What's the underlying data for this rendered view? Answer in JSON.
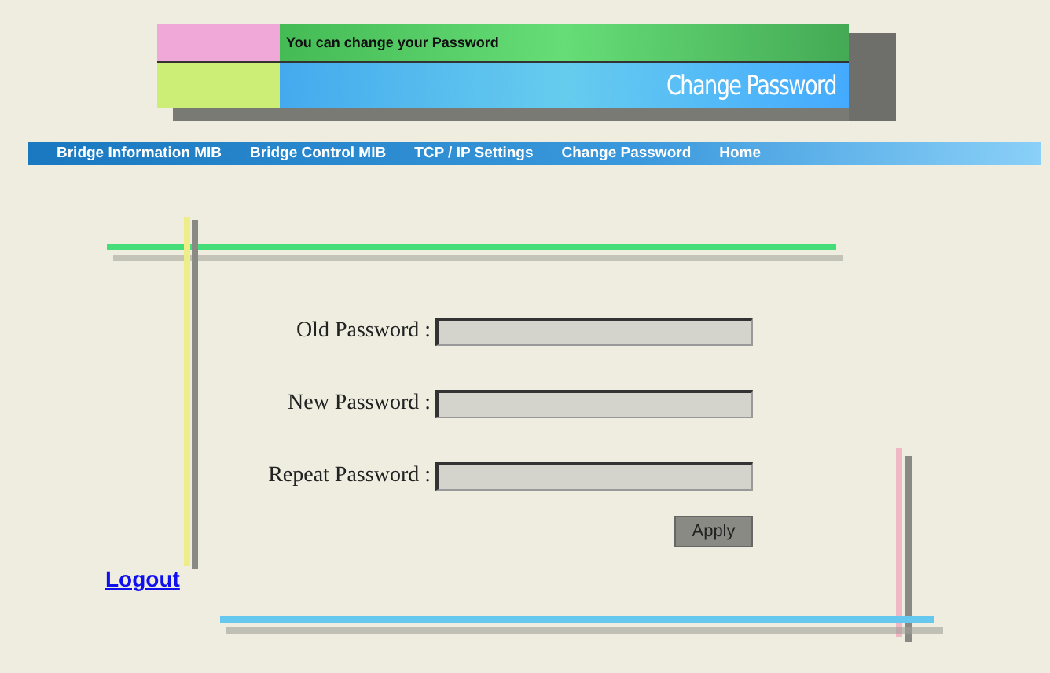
{
  "banner": {
    "caption": "You can change your Password",
    "title": "Change Password"
  },
  "nav": [
    {
      "label": "Bridge Information MIB"
    },
    {
      "label": "Bridge Control MIB"
    },
    {
      "label": "TCP / IP Settings"
    },
    {
      "label": "Change Password"
    },
    {
      "label": "Home"
    }
  ],
  "form": {
    "fields": [
      {
        "label": "Old Password :"
      },
      {
        "label": "New Password :"
      },
      {
        "label": "Repeat Password :"
      }
    ],
    "button": "Apply"
  },
  "logout": "Logout"
}
